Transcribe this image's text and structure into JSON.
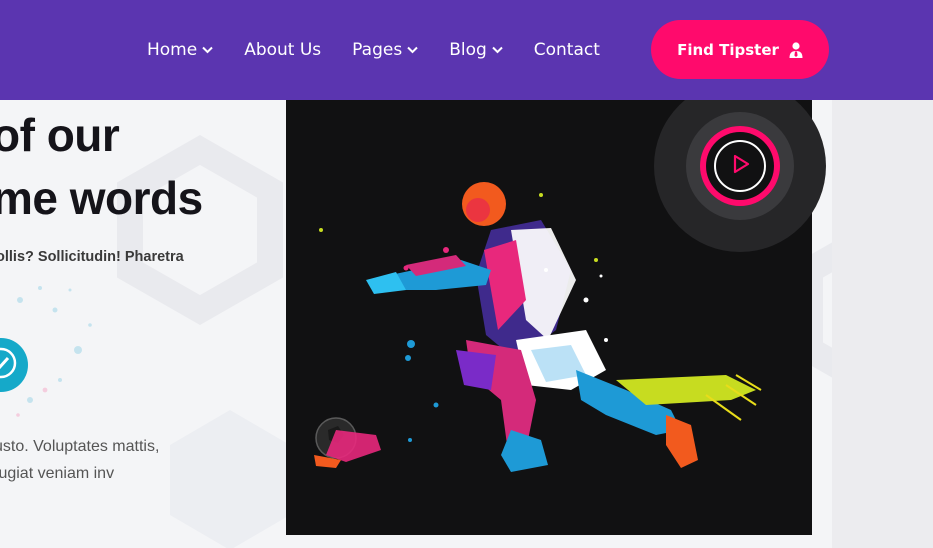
{
  "nav": {
    "items": [
      {
        "label": "Home",
        "has_dropdown": true
      },
      {
        "label": "About Us",
        "has_dropdown": false
      },
      {
        "label": "Pages",
        "has_dropdown": true
      },
      {
        "label": "Blog",
        "has_dropdown": true
      },
      {
        "label": "Contact",
        "has_dropdown": false
      }
    ],
    "cta_label": "Find Tipster",
    "cta_icon": "user-tie-icon"
  },
  "hero": {
    "heading_line1": "of our",
    "heading_line2": "me words",
    "subtext": "ollis? Sollicitudin! Pharetra",
    "badge_icon": "shield-check-icon",
    "para_line1": "usto. Voluptates mattis,",
    "para_line2": "fugiat veniam inv"
  },
  "media": {
    "image": "football-player-paint-splash",
    "play_icon": "play-icon"
  },
  "colors": {
    "nav_bg": "#5b35b0",
    "accent": "#ff0a6c",
    "badge": "#15a9c9",
    "card_bg": "#111112"
  }
}
